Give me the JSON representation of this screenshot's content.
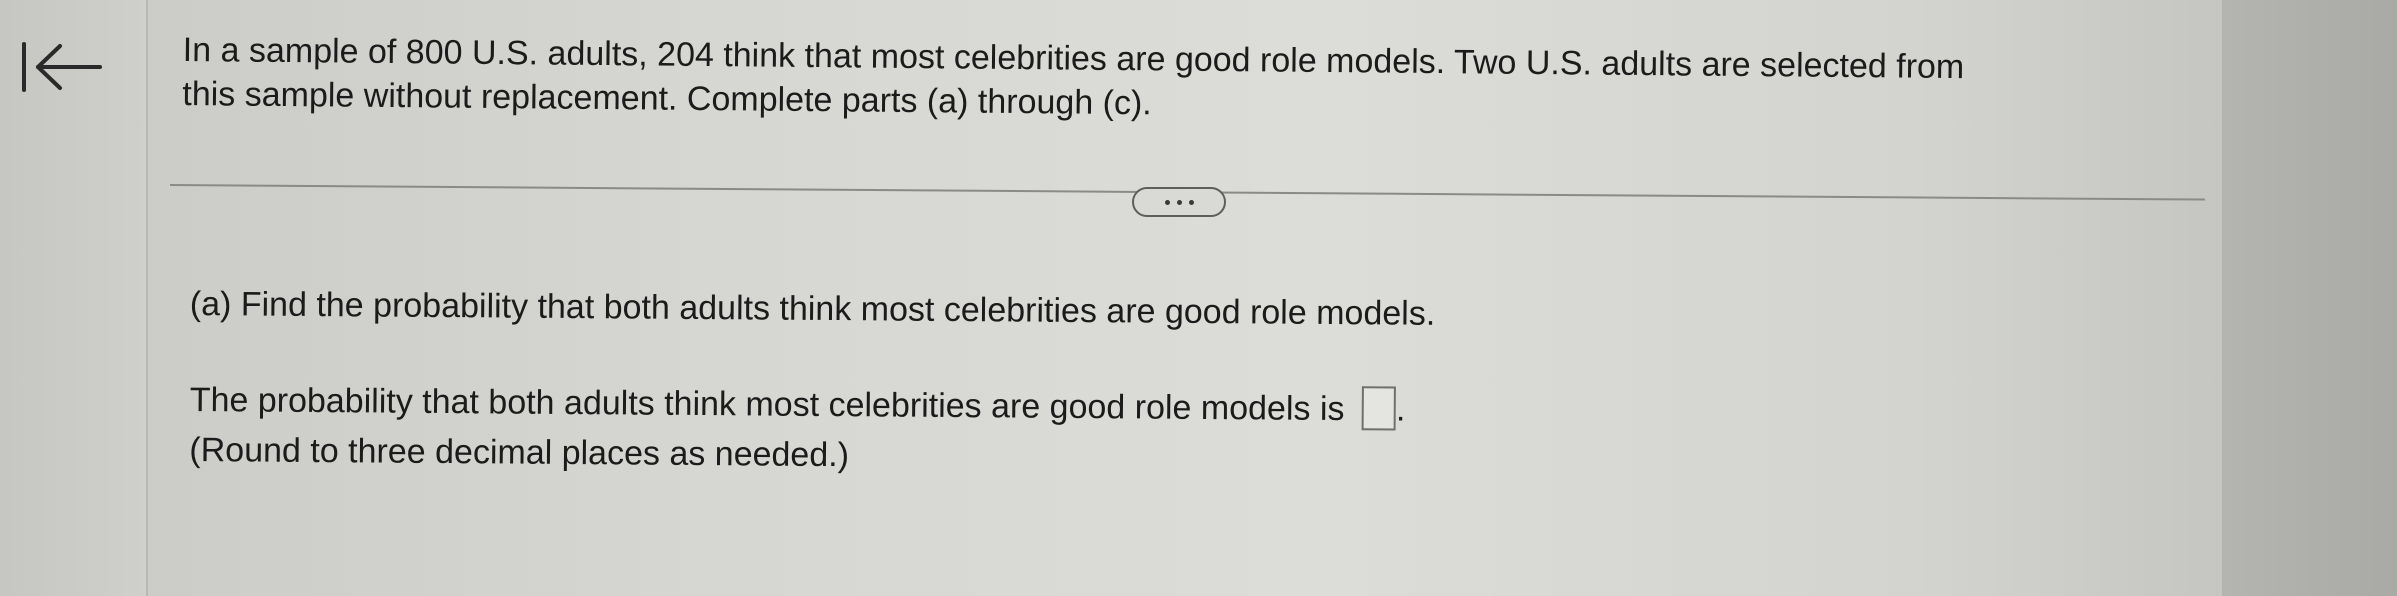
{
  "nav": {
    "back_icon": "collapse-left-icon"
  },
  "question": {
    "line1": "In a sample of 800 U.S. adults, 204 think that most celebrities are good role models. Two U.S. adults are selected from",
    "line2": "this sample without replacement. Complete parts (a) through (c)."
  },
  "more_button": {
    "icon": "more-dots-icon"
  },
  "part_a": {
    "prompt": "(a) Find the probability that both adults think most celebrities are good role models.",
    "answer_prefix": "The probability that both adults think most celebrities are good role models is",
    "answer_value": "",
    "answer_suffix": ".",
    "note": "(Round to three decimal places as needed.)"
  }
}
